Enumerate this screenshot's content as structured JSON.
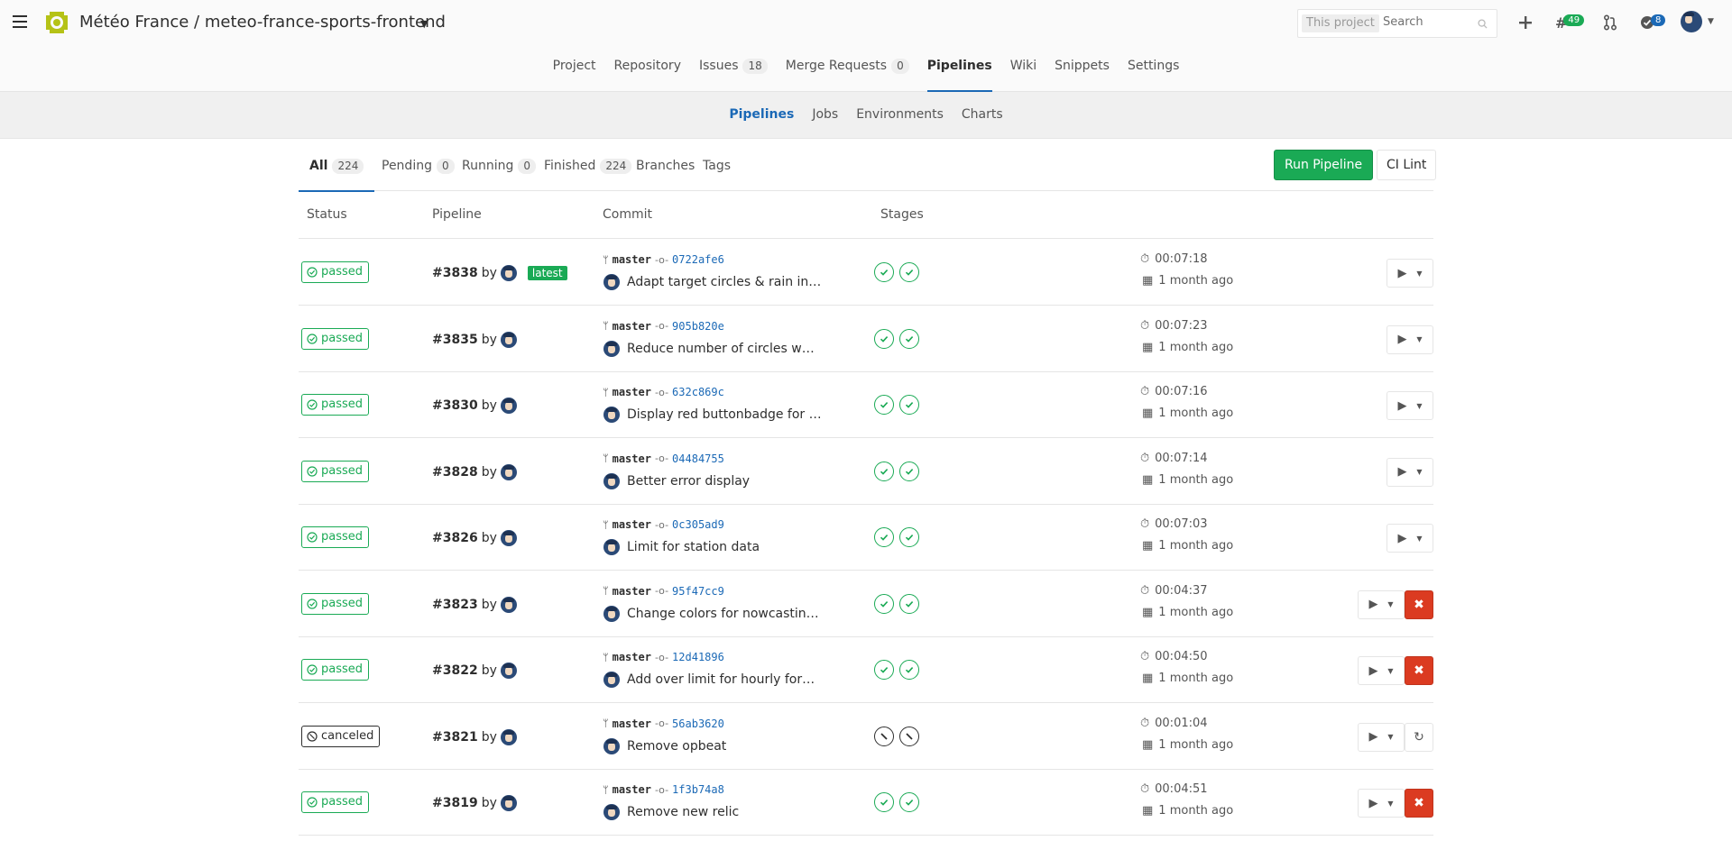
{
  "header": {
    "title": "Météo France / meteo-france-sports-frontend",
    "search_scope": "This project",
    "search_placeholder": "Search",
    "todo_count": "49",
    "issue_count": "8"
  },
  "project_nav": [
    {
      "label": "Project"
    },
    {
      "label": "Repository"
    },
    {
      "label": "Issues",
      "count": "18"
    },
    {
      "label": "Merge Requests",
      "count": "0"
    },
    {
      "label": "Pipelines",
      "active": true
    },
    {
      "label": "Wiki"
    },
    {
      "label": "Snippets"
    },
    {
      "label": "Settings"
    }
  ],
  "sub_nav": [
    {
      "label": "Pipelines",
      "active": true
    },
    {
      "label": "Jobs"
    },
    {
      "label": "Environments"
    },
    {
      "label": "Charts"
    }
  ],
  "tabs": [
    {
      "label": "All",
      "count": "224",
      "active": true
    },
    {
      "label": "Pending",
      "count": "0"
    },
    {
      "label": "Running",
      "count": "0"
    },
    {
      "label": "Finished",
      "count": "224"
    },
    {
      "label": "Branches"
    },
    {
      "label": "Tags"
    }
  ],
  "buttons": {
    "run_pipeline": "Run Pipeline",
    "ci_lint": "CI Lint"
  },
  "table": {
    "headers": [
      "Status",
      "Pipeline",
      "Commit",
      "Stages"
    ],
    "rows": [
      {
        "status": "passed",
        "id": "#3838",
        "by": "by",
        "latest": "latest",
        "ref": "master",
        "sha": "0722afe6",
        "message": "Adapt target circles & rain in…",
        "stages": [
          "passed",
          "passed"
        ],
        "duration": "00:07:18",
        "finished": "1 month ago",
        "action": "none"
      },
      {
        "status": "passed",
        "id": "#3835",
        "by": "by",
        "ref": "master",
        "sha": "905b820e",
        "message": "Reduce number of circles w…",
        "stages": [
          "passed",
          "passed"
        ],
        "duration": "00:07:23",
        "finished": "1 month ago",
        "action": "none"
      },
      {
        "status": "passed",
        "id": "#3830",
        "by": "by",
        "ref": "master",
        "sha": "632c869c",
        "message": "Display red buttonbadge for …",
        "stages": [
          "passed",
          "passed"
        ],
        "duration": "00:07:16",
        "finished": "1 month ago",
        "action": "none"
      },
      {
        "status": "passed",
        "id": "#3828",
        "by": "by",
        "ref": "master",
        "sha": "04484755",
        "message": "Better error display",
        "stages": [
          "passed",
          "passed"
        ],
        "duration": "00:07:14",
        "finished": "1 month ago",
        "action": "none"
      },
      {
        "status": "passed",
        "id": "#3826",
        "by": "by",
        "ref": "master",
        "sha": "0c305ad9",
        "message": "Limit for station data",
        "stages": [
          "passed",
          "passed"
        ],
        "duration": "00:07:03",
        "finished": "1 month ago",
        "action": "none"
      },
      {
        "status": "passed",
        "id": "#3823",
        "by": "by",
        "ref": "master",
        "sha": "95f47cc9",
        "message": "Change colors for nowcastin…",
        "stages": [
          "passed",
          "passed"
        ],
        "duration": "00:04:37",
        "finished": "1 month ago",
        "action": "cancel"
      },
      {
        "status": "passed",
        "id": "#3822",
        "by": "by",
        "ref": "master",
        "sha": "12d41896",
        "message": "Add over limit for hourly for…",
        "stages": [
          "passed",
          "passed"
        ],
        "duration": "00:04:50",
        "finished": "1 month ago",
        "action": "cancel"
      },
      {
        "status": "canceled",
        "id": "#3821",
        "by": "by",
        "ref": "master",
        "sha": "56ab3620",
        "message": "Remove opbeat",
        "stages": [
          "canceled",
          "canceled"
        ],
        "duration": "00:01:04",
        "finished": "1 month ago",
        "action": "retry"
      },
      {
        "status": "passed",
        "id": "#3819",
        "by": "by",
        "ref": "master",
        "sha": "1f3b74a8",
        "message": "Remove new relic",
        "stages": [
          "passed",
          "passed"
        ],
        "duration": "00:04:51",
        "finished": "1 month ago",
        "action": "cancel"
      }
    ]
  },
  "colors": {
    "success": "#1aaa55",
    "danger": "#db3b21",
    "link": "#1b69b6"
  }
}
